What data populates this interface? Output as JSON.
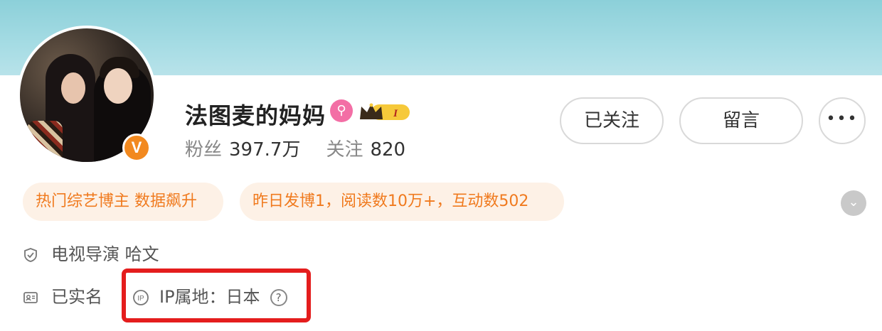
{
  "profile": {
    "name": "法图麦的妈妈",
    "verified_badge": "V",
    "pink_badge_icon": "pink-membership-icon",
    "level_badge_text": "I",
    "stats": {
      "fans_label": "粉丝",
      "fans_value": "397.7万",
      "following_label": "关注",
      "following_value": "820"
    }
  },
  "actions": {
    "follow_label": "已关注",
    "message_label": "留言",
    "more_label": "•••"
  },
  "tags": [
    "热门综艺博主 数据飙升",
    "昨日发博1，阅读数10万+，互动数502"
  ],
  "info": {
    "occupation": "电视导演 哈文",
    "realname": "已实名",
    "ip_location": "IP属地：日本"
  },
  "colors": {
    "cover": "#a6dce4",
    "tag_bg": "#fdf1e6",
    "tag_text": "#f07a1e",
    "highlight": "#e41d1d",
    "verified": "#f2891f"
  }
}
